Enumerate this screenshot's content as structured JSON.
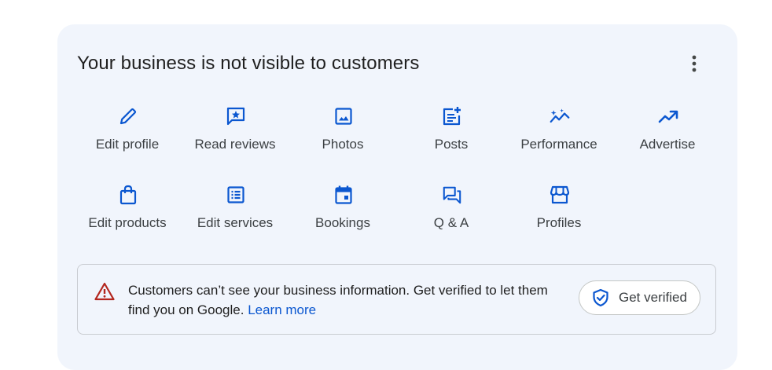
{
  "card": {
    "title": "Your business is not visible to customers",
    "more_icon": "more-vert-icon"
  },
  "actions": [
    {
      "label": "Edit profile",
      "icon": "pencil-icon"
    },
    {
      "label": "Read reviews",
      "icon": "review-star-icon"
    },
    {
      "label": "Photos",
      "icon": "photo-icon"
    },
    {
      "label": "Posts",
      "icon": "post-add-icon"
    },
    {
      "label": "Performance",
      "icon": "performance-sparkle-icon"
    },
    {
      "label": "Advertise",
      "icon": "trending-up-icon"
    },
    {
      "label": "Edit products",
      "icon": "shopping-bag-icon"
    },
    {
      "label": "Edit services",
      "icon": "list-alt-icon"
    },
    {
      "label": "Bookings",
      "icon": "calendar-icon"
    },
    {
      "label": "Q & A",
      "icon": "forum-icon"
    },
    {
      "label": "Profiles",
      "icon": "storefront-icon"
    }
  ],
  "banner": {
    "message": "Customers can’t see your business information. Get verified to let them find you on Google.",
    "learn_more": "Learn more",
    "button_label": "Get verified",
    "warning_icon": "warning-icon",
    "shield_icon": "verified-shield-icon"
  },
  "colors": {
    "card_bg": "#f1f5fc",
    "icon_blue": "#0b57d0",
    "warning_red": "#b3261e",
    "text": "#1f1f1f"
  }
}
